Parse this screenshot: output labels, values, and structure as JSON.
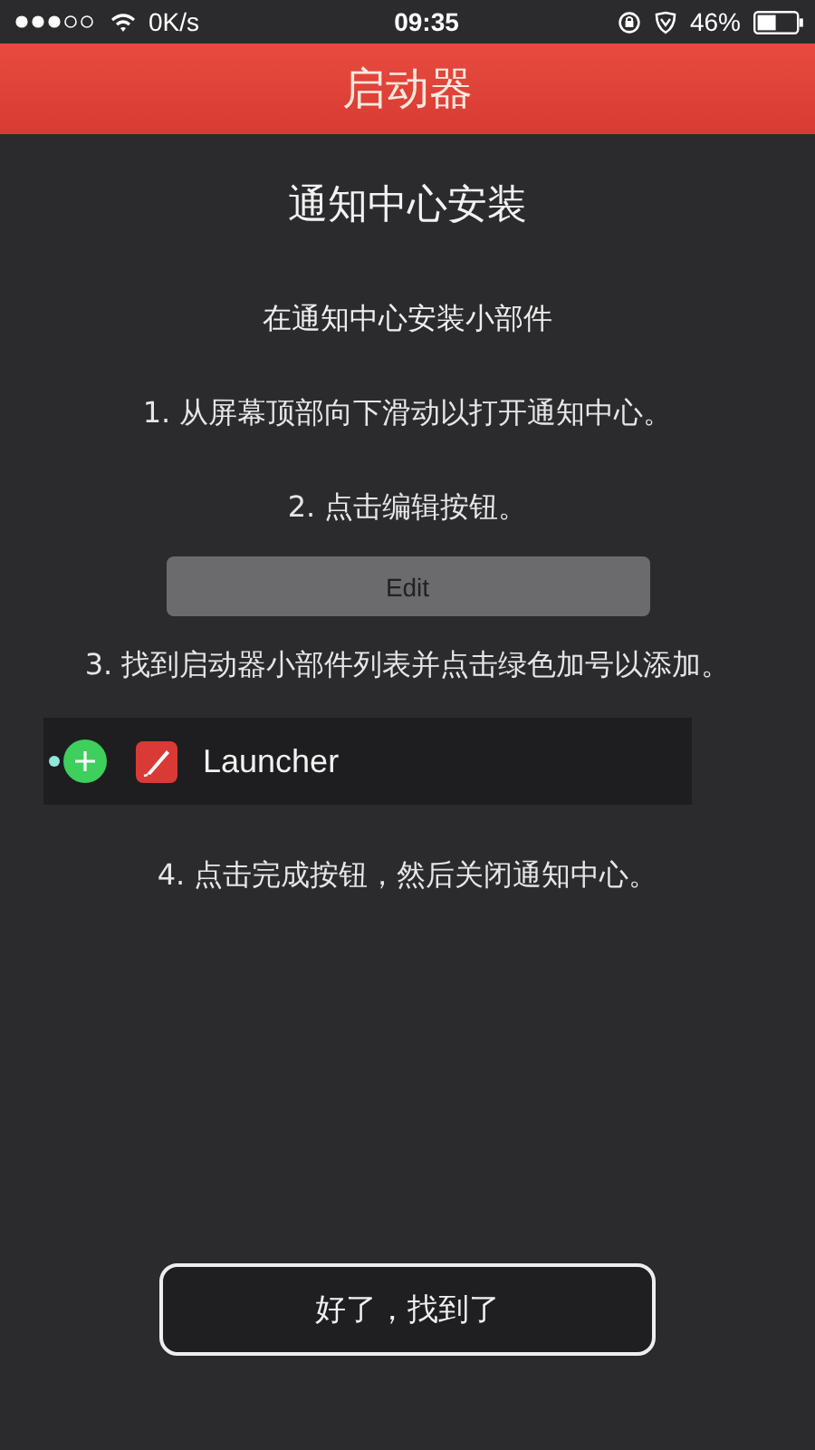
{
  "status_bar": {
    "speed": "0K/s",
    "time": "09:35",
    "battery": "46%"
  },
  "header": {
    "title": "启动器"
  },
  "heading": "通知中心安装",
  "subtitle": "在通知中心安装小部件",
  "steps": [
    {
      "kind": "text",
      "text": "1. 从屏幕顶部向下滑动以打开通知中心。"
    },
    {
      "kind": "text",
      "text": "2. 点击编辑按钮。"
    },
    {
      "kind": "button",
      "label": "Edit"
    },
    {
      "kind": "text",
      "text": "3. 找到启动器小部件列表并点击绿色加号以添加。"
    },
    {
      "kind": "widget",
      "label": "Launcher"
    },
    {
      "kind": "text",
      "text": "4. 点击完成按钮，然后关闭通知中心。"
    }
  ],
  "confirm_button": "好了，找到了"
}
